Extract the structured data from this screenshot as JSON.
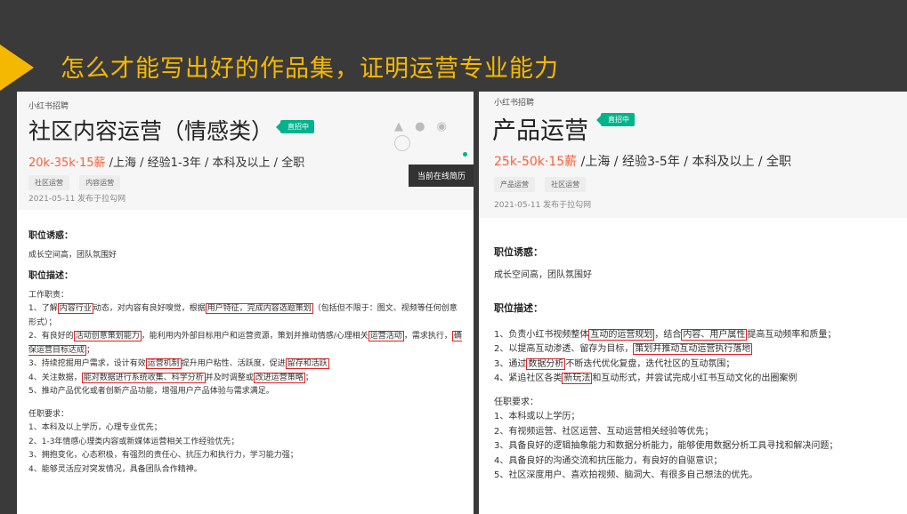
{
  "slide": {
    "title": "怎么才能写出好的作品集，证明运营专业能力"
  },
  "left_job": {
    "source": "小红书招聘",
    "title": "社区内容运营（情感类）",
    "badge": "直招中",
    "salary": "20k-35k·15薪",
    "meta": " /上海 / 经验1-3年 / 本科及以上 / 全职",
    "tags": [
      "社区运营",
      "内容运营"
    ],
    "date": "2021-05-11  发布于拉勾网",
    "tooltip": "当前在线简历",
    "perks_heading": "职位诱惑：",
    "perks": "成长空间高，团队氛围好",
    "desc_heading": "职位描述：",
    "duties_heading": "工作职责：",
    "duties": [
      {
        "pre": "1、了解",
        "h1": "内容行业",
        "mid1": "动态，对内容有良好嗅觉，根据",
        "h2": "用户特征，完成内容选题策划",
        "post": "（包括但不限于：图文、视频等任何创意形式）；"
      },
      {
        "pre": "2、有良好的",
        "h1": "活动创意策划能力",
        "mid1": "，能利用内外部目标用户和运营资源，策划并推动情感/心理相关",
        "h2": "运营活动",
        "post": "，需求执行，",
        "h3": "确保运营目标达成",
        "end": "；"
      },
      {
        "pre": "3、持续挖掘用户需求，设计有效",
        "h1": "运营机制",
        "mid1": "提升用户粘性、活跃度，促进",
        "h2": "留存和活跃",
        "post": ""
      },
      {
        "pre": "4、关注数据，",
        "h1": "能对数据进行系统收集、科学分析",
        "mid1": "并及时调整或",
        "h2": "改进运营策略",
        "post": "；"
      },
      {
        "pre": "5、推动产品优化或者创新产品功能，增强用户产品体验与需求满足。"
      }
    ],
    "req_heading": "任职要求：",
    "reqs": [
      "1、本科及以上学历，心理专业优先；",
      "2、1-3年情感心理类内容或新媒体运营相关工作经验优先；",
      "3、拥抱变化，心态积极，有强烈的责任心、抗压力和执行力，学习能力强；",
      "4、能够灵活应对突发情况，具备团队合作精神。"
    ]
  },
  "right_job": {
    "source": "小红书招聘",
    "title": "产品运营",
    "badge": "直招中",
    "salary": "25k-50k·15薪",
    "meta": " /上海 / 经验3-5年 / 本科及以上 / 全职",
    "tags": [
      "产品运营",
      "社区运营"
    ],
    "date": "2021-05-11  发布于拉勾网",
    "perks_heading": "职位诱惑：",
    "perks": "成长空间高，团队氛围好",
    "desc_heading": "职位描述：",
    "duties": [
      {
        "pre": "1、负责小红书视频整体",
        "h1": "互动的运营规划",
        "mid1": "，结合",
        "h2": "内容、用户属性",
        "post": "提高互动频率和质量；"
      },
      {
        "pre": "2、以提高互动渗透、留存为目标，",
        "h1": "策划并推动互动运营执行落地",
        "post": ""
      },
      {
        "pre": "3、通过",
        "h1": "数据分析",
        "post": "不断迭代优化复盘，迭代社区的互动氛围；"
      },
      {
        "pre": "4、紧追社区各类",
        "h1": "新玩法",
        "post": "和互动形式，并尝试完成小红书互动文化的出圈案例"
      }
    ],
    "req_heading": "任职要求：",
    "reqs": [
      "1、本科或以上学历；",
      "2、有视频运营、社区运营、互动运营相关经验等优先；",
      "3、具备良好的逻辑抽象能力和数据分析能力，能够使用数据分析工具寻找和解决问题；",
      "4、具备良好的沟通交流和抗压能力，有良好的自驱意识；",
      "5、社区深度用户、喜欢拍视频、脑洞大、有很多自己想法的优先。"
    ]
  }
}
